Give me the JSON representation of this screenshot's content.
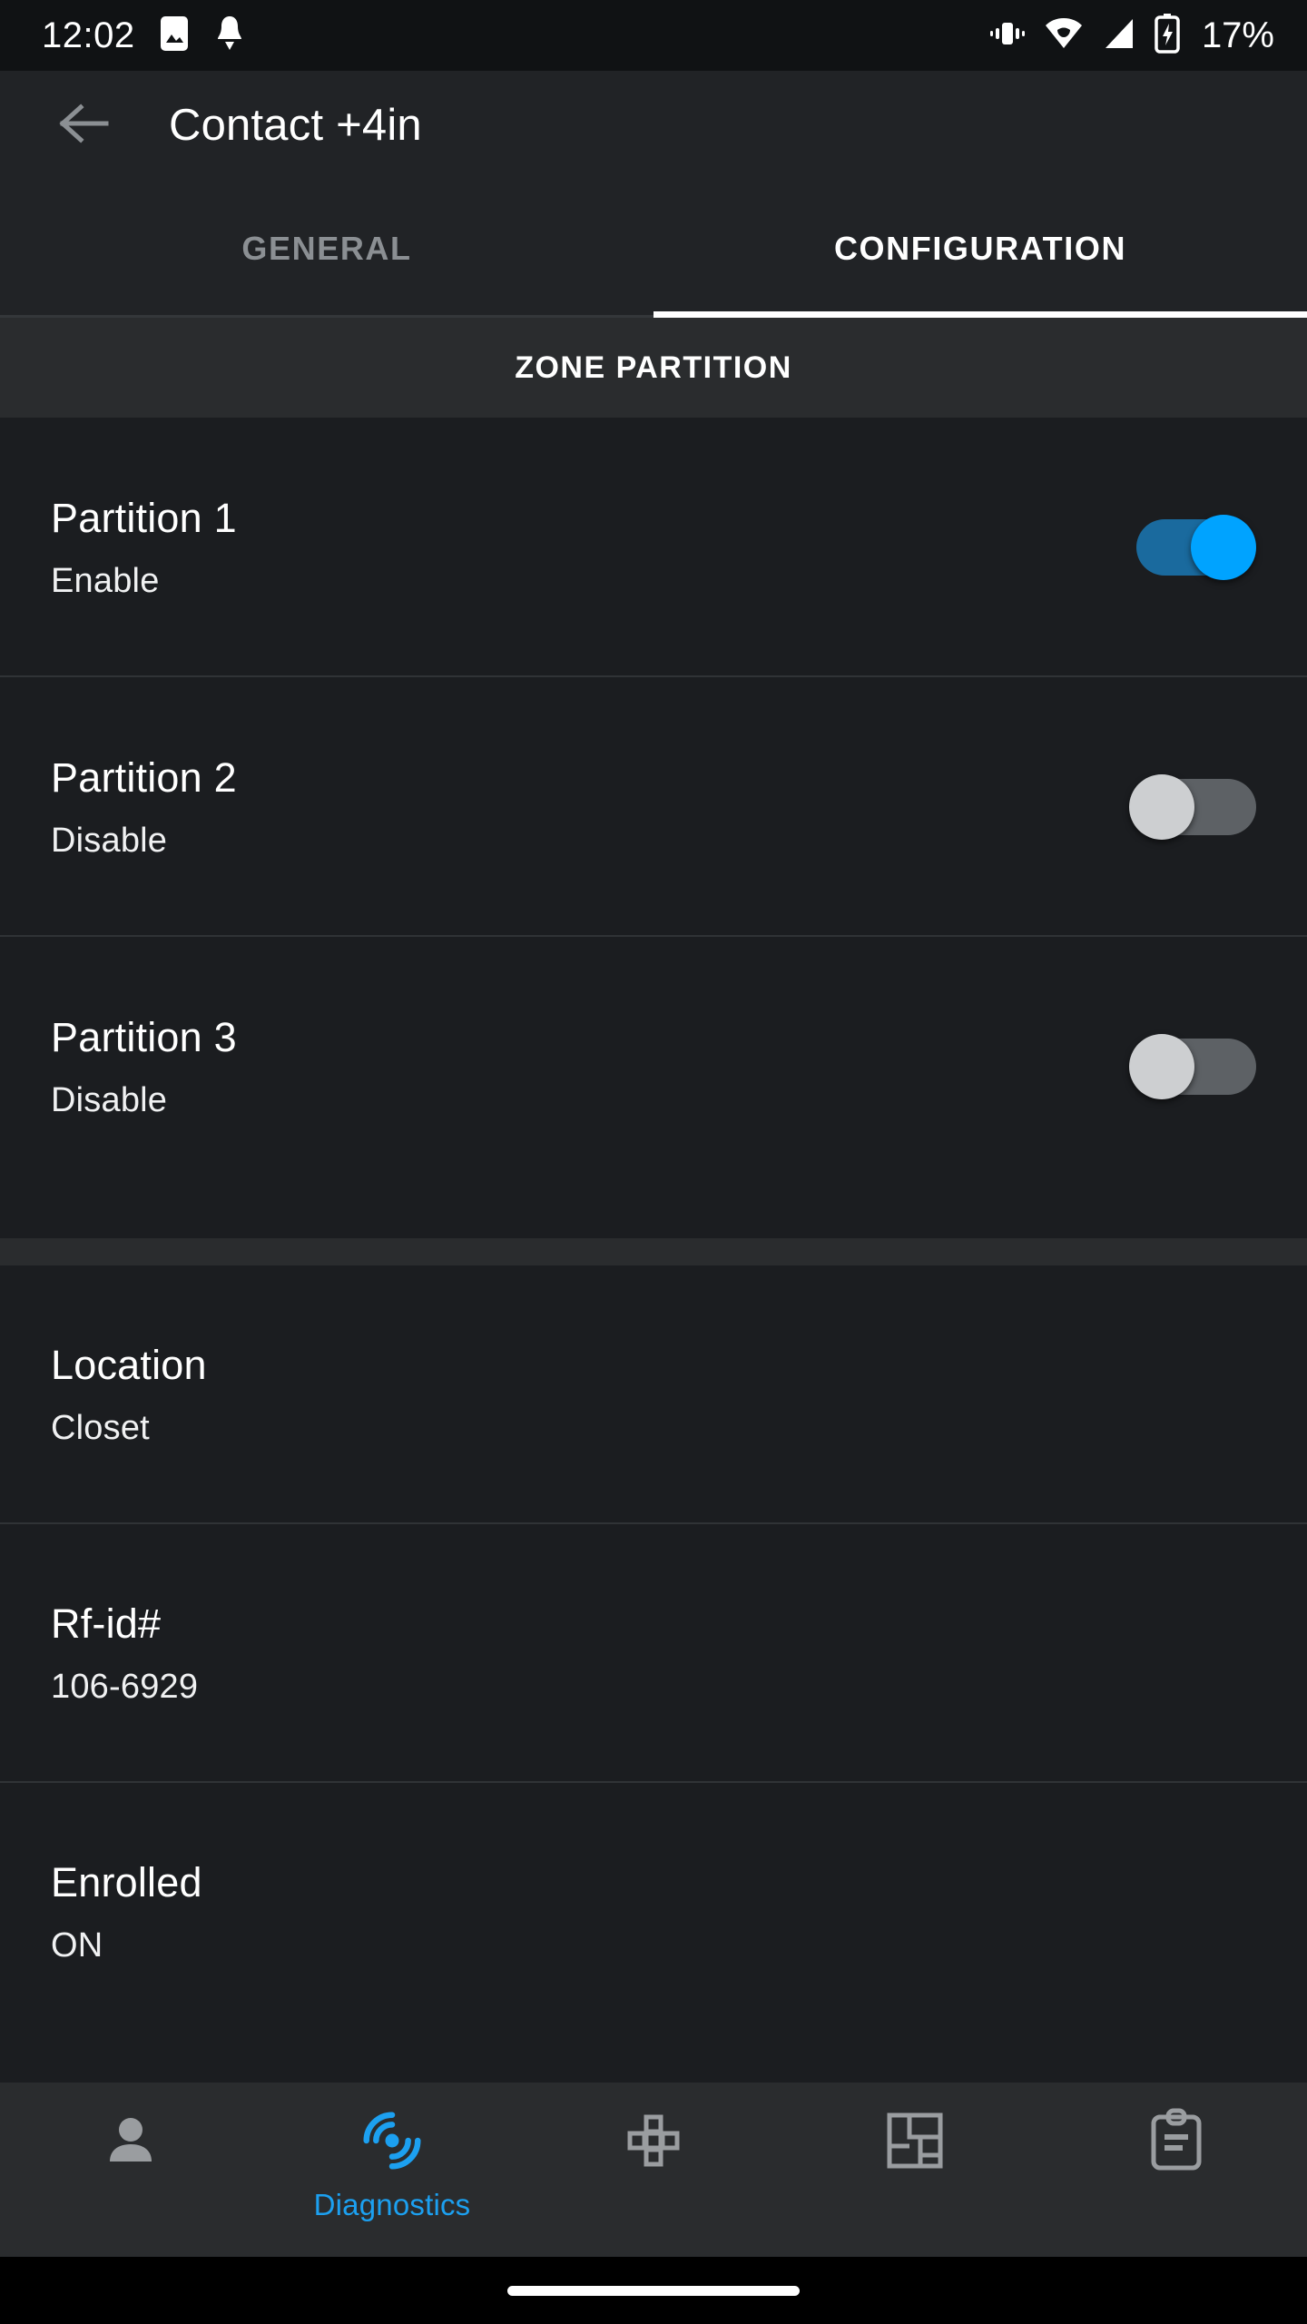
{
  "status_bar": {
    "time": "12:02",
    "battery_percent": "17%",
    "left_icons": [
      "photo-icon",
      "notification-bell-icon"
    ],
    "right_icons": [
      "vibrate-icon",
      "wifi-icon",
      "cellular-signal-icon",
      "battery-charging-icon"
    ]
  },
  "app_bar": {
    "back_icon": "back-arrow-icon",
    "title": "Contact +4in"
  },
  "tabs": [
    {
      "label": "GENERAL",
      "active": false
    },
    {
      "label": "CONFIGURATION",
      "active": true
    }
  ],
  "sections": [
    {
      "header": "ZONE PARTITION",
      "rows": [
        {
          "label": "Partition 1",
          "value": "Enable",
          "toggle": "on"
        },
        {
          "label": "Partition 2",
          "value": "Disable",
          "toggle": "off"
        },
        {
          "label": "Partition 3",
          "value": "Disable",
          "toggle": "off"
        }
      ]
    },
    {
      "header": "",
      "rows": [
        {
          "label": "Location",
          "value": "Closet"
        },
        {
          "label": "Rf-id#",
          "value": "106-6929"
        },
        {
          "label": "Enrolled",
          "value": "ON"
        }
      ]
    }
  ],
  "bottom_nav": [
    {
      "icon": "person-icon",
      "label": "",
      "active": false
    },
    {
      "icon": "diagnostics-radar-icon",
      "label": "Diagnostics",
      "active": true
    },
    {
      "icon": "keypad-icon",
      "label": "",
      "active": false
    },
    {
      "icon": "floorplan-icon",
      "label": "",
      "active": false
    },
    {
      "icon": "clipboard-icon",
      "label": "",
      "active": false
    }
  ],
  "colors": {
    "accent": "#00a3ff",
    "nav_active": "#1ca0f0",
    "toggle_on_track": "#1a6a9e",
    "toggle_off_track": "#5d6165",
    "toggle_off_thumb": "#cdcfd1",
    "background": "#1b1d20",
    "surface": "#212326",
    "section_band": "#2a2c2e",
    "text_primary": "#ffffff",
    "text_inactive": "#8b8f93",
    "icon_inactive": "#9a9da0"
  }
}
